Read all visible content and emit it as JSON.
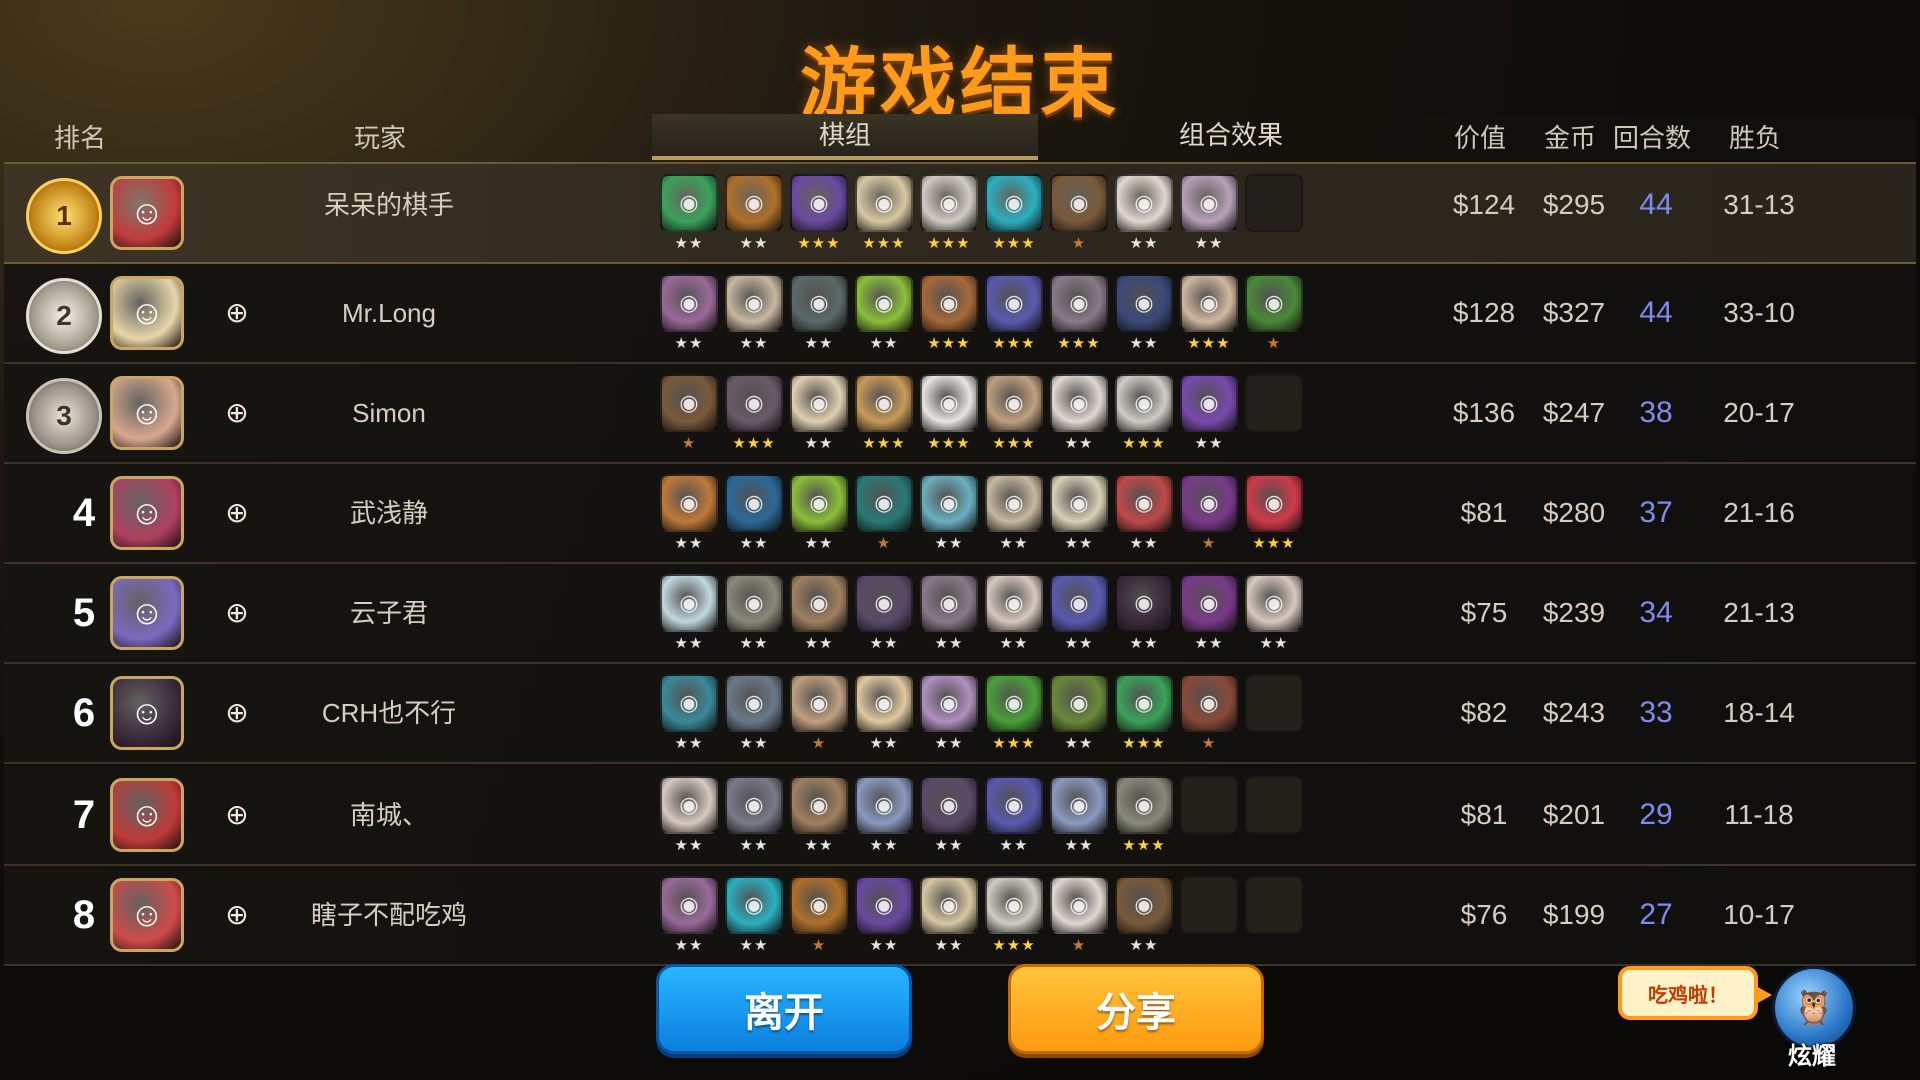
{
  "title": "游戏结束",
  "headers": {
    "rank": "排名",
    "player": "玩家",
    "lineup_tab": "棋组",
    "synergy_tab": "组合效果",
    "value": "价值",
    "gold": "金币",
    "rounds": "回合数",
    "win_loss": "胜负"
  },
  "players": [
    {
      "rank": "1",
      "name": "呆呆的棋手",
      "value": "$124",
      "gold": "$295",
      "rounds": "44",
      "wl": "31-13",
      "medal": "gold",
      "avatar_color": "#c23b3b",
      "friend_icon": false,
      "units": [
        {
          "c": "#3aa35a",
          "s": "★★",
          "t": "white"
        },
        {
          "c": "#b0702a",
          "s": "★★",
          "t": "white"
        },
        {
          "c": "#6a4aa0",
          "s": "★★★",
          "t": "gold"
        },
        {
          "c": "#d8c7a2",
          "s": "★★★",
          "t": "gold"
        },
        {
          "c": "#d0ccc4",
          "s": "★★★",
          "t": "gold"
        },
        {
          "c": "#2ab0c0",
          "s": "★★★",
          "t": "gold"
        },
        {
          "c": "#7a5a3a",
          "s": "★",
          "t": "bronze"
        },
        {
          "c": "#e0d8d0",
          "s": "★★",
          "t": "white"
        },
        {
          "c": "#b8a0b8",
          "s": "★★",
          "t": "white"
        },
        null
      ]
    },
    {
      "rank": "2",
      "name": "Mr.Long",
      "value": "$128",
      "gold": "$327",
      "rounds": "44",
      "wl": "33-10",
      "medal": "silver",
      "avatar_color": "#e8d6a8",
      "friend_icon": true,
      "units": [
        {
          "c": "#9a6a9a",
          "s": "★★",
          "t": "white"
        },
        {
          "c": "#c8b8a0",
          "s": "★★",
          "t": "white"
        },
        {
          "c": "#5a6a6a",
          "s": "★★",
          "t": "white"
        },
        {
          "c": "#8ac03a",
          "s": "★★",
          "t": "white"
        },
        {
          "c": "#a86a3a",
          "s": "★★★",
          "t": "gold"
        },
        {
          "c": "#5a5ab0",
          "s": "★★★",
          "t": "gold"
        },
        {
          "c": "#8a7a8a",
          "s": "★★★",
          "t": "gold"
        },
        {
          "c": "#3a4a7a",
          "s": "★★",
          "t": "white"
        },
        {
          "c": "#d0b8a0",
          "s": "★★★",
          "t": "gold"
        },
        {
          "c": "#4a8a3a",
          "s": "★",
          "t": "bronze"
        }
      ]
    },
    {
      "rank": "3",
      "name": "Simon",
      "value": "$136",
      "gold": "$247",
      "rounds": "38",
      "wl": "20-17",
      "medal": "bronze",
      "avatar_color": "#d8a890",
      "friend_icon": true,
      "units": [
        {
          "c": "#7a5a3a",
          "s": "★",
          "t": "bronze"
        },
        {
          "c": "#6a5a6a",
          "s": "★★★",
          "t": "gold"
        },
        {
          "c": "#e0d0b0",
          "s": "★★",
          "t": "white"
        },
        {
          "c": "#c89a5a",
          "s": "★★★",
          "t": "gold"
        },
        {
          "c": "#e8e4e0",
          "s": "★★★",
          "t": "gold"
        },
        {
          "c": "#c0a080",
          "s": "★★★",
          "t": "gold"
        },
        {
          "c": "#e0d8d0",
          "s": "★★",
          "t": "white"
        },
        {
          "c": "#d0ccc4",
          "s": "★★★",
          "t": "gold"
        },
        {
          "c": "#7a4ab0",
          "s": "★★",
          "t": "white"
        },
        null
      ]
    },
    {
      "rank": "4",
      "name": "武浅静",
      "value": "$81",
      "gold": "$280",
      "rounds": "37",
      "wl": "21-16",
      "medal": "none",
      "avatar_color": "#b04060",
      "friend_icon": true,
      "units": [
        {
          "c": "#c07a3a",
          "s": "★★",
          "t": "white"
        },
        {
          "c": "#2a6a9a",
          "s": "★★",
          "t": "white"
        },
        {
          "c": "#8ac03a",
          "s": "★★",
          "t": "white"
        },
        {
          "c": "#2a7a7a",
          "s": "★",
          "t": "bronze"
        },
        {
          "c": "#6ab0c0",
          "s": "★★",
          "t": "white"
        },
        {
          "c": "#c8b8a0",
          "s": "★★",
          "t": "white"
        },
        {
          "c": "#d8d0b8",
          "s": "★★",
          "t": "white"
        },
        {
          "c": "#c04a4a",
          "s": "★★",
          "t": "white"
        },
        {
          "c": "#7a3a8a",
          "s": "★",
          "t": "bronze"
        },
        {
          "c": "#d03a4a",
          "s": "★★★",
          "t": "gold"
        }
      ]
    },
    {
      "rank": "5",
      "name": "云子君",
      "value": "$75",
      "gold": "$239",
      "rounds": "34",
      "wl": "21-13",
      "medal": "none",
      "avatar_color": "#7a6ac0",
      "friend_icon": true,
      "units": [
        {
          "c": "#c0d8e0",
          "s": "★★",
          "t": "white"
        },
        {
          "c": "#8a8a7a",
          "s": "★★",
          "t": "white"
        },
        {
          "c": "#a08060",
          "s": "★★",
          "t": "white"
        },
        {
          "c": "#5a4a6a",
          "s": "★★",
          "t": "white"
        },
        {
          "c": "#8a7a8a",
          "s": "★★",
          "t": "white"
        },
        {
          "c": "#d8c8c0",
          "s": "★★",
          "t": "white"
        },
        {
          "c": "#5a5ab0",
          "s": "★★",
          "t": "white"
        },
        {
          "c": "#3a2a3a",
          "s": "★★",
          "t": "white"
        },
        {
          "c": "#7a3a8a",
          "s": "★★",
          "t": "white"
        },
        {
          "c": "#d8c8c0",
          "s": "★★",
          "t": "white"
        }
      ]
    },
    {
      "rank": "6",
      "name": "CRH也不行",
      "value": "$82",
      "gold": "$243",
      "rounds": "33",
      "wl": "18-14",
      "medal": "none",
      "avatar_color": "#3a2a3a",
      "friend_icon": true,
      "units": [
        {
          "c": "#3a8a9a",
          "s": "★★",
          "t": "white"
        },
        {
          "c": "#6a7a8a",
          "s": "★★",
          "t": "white"
        },
        {
          "c": "#c0a080",
          "s": "★",
          "t": "bronze"
        },
        {
          "c": "#e0c8a0",
          "s": "★★",
          "t": "white"
        },
        {
          "c": "#b090c0",
          "s": "★★",
          "t": "white"
        },
        {
          "c": "#4aa03a",
          "s": "★★★",
          "t": "gold"
        },
        {
          "c": "#6a8a3a",
          "s": "★★",
          "t": "white"
        },
        {
          "c": "#3aa35a",
          "s": "★★★",
          "t": "gold"
        },
        {
          "c": "#8a4a3a",
          "s": "★",
          "t": "bronze"
        },
        null
      ]
    },
    {
      "rank": "7",
      "name": "南城、",
      "value": "$81",
      "gold": "$201",
      "rounds": "29",
      "wl": "11-18",
      "medal": "none",
      "avatar_color": "#c03a3a",
      "friend_icon": true,
      "units": [
        {
          "c": "#d8c8c0",
          "s": "★★",
          "t": "white"
        },
        {
          "c": "#7a7a8a",
          "s": "★★",
          "t": "white"
        },
        {
          "c": "#a08060",
          "s": "★★",
          "t": "white"
        },
        {
          "c": "#8a9ac0",
          "s": "★★",
          "t": "white"
        },
        {
          "c": "#5a4a6a",
          "s": "★★",
          "t": "white"
        },
        {
          "c": "#5a5ab0",
          "s": "★★",
          "t": "white"
        },
        {
          "c": "#8a9ac0",
          "s": "★★",
          "t": "white"
        },
        {
          "c": "#8a8a7a",
          "s": "★★★",
          "t": "gold"
        },
        null,
        null
      ]
    },
    {
      "rank": "8",
      "name": "瞎子不配吃鸡",
      "value": "$76",
      "gold": "$199",
      "rounds": "27",
      "wl": "10-17",
      "medal": "none",
      "avatar_color": "#d04a4a",
      "friend_icon": true,
      "units": [
        {
          "c": "#9a6a9a",
          "s": "★★",
          "t": "white"
        },
        {
          "c": "#2ab0c0",
          "s": "★★",
          "t": "white"
        },
        {
          "c": "#b0702a",
          "s": "★",
          "t": "bronze"
        },
        {
          "c": "#6a4aa0",
          "s": "★★",
          "t": "white"
        },
        {
          "c": "#d8c7a2",
          "s": "★★",
          "t": "white"
        },
        {
          "c": "#d0ccc4",
          "s": "★★★",
          "t": "gold"
        },
        {
          "c": "#e0d8d0",
          "s": "★",
          "t": "bronze"
        },
        {
          "c": "#7a5a3a",
          "s": "★★",
          "t": "white"
        },
        null,
        null
      ]
    }
  ],
  "buttons": {
    "leave": "离开",
    "share": "分享"
  },
  "bubble_text": "吃鸡啦！",
  "mascot_label": "炫耀",
  "icons": {
    "friend": "add-friend-icon",
    "medal": "rank-medal-icon",
    "mascot": "owl-mascot-icon"
  }
}
